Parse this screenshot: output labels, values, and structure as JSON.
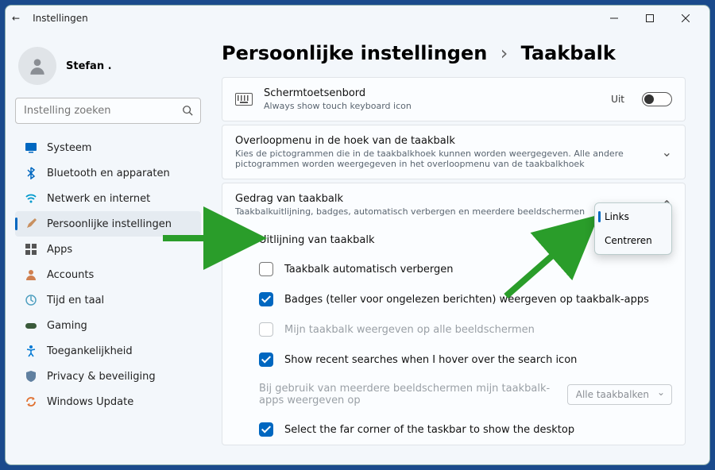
{
  "window": {
    "title": "Instellingen",
    "user": "Stefan .",
    "search_placeholder": "Instelling zoeken"
  },
  "nav": [
    {
      "label": "Systeem",
      "icon": "system"
    },
    {
      "label": "Bluetooth en apparaten",
      "icon": "bluetooth"
    },
    {
      "label": "Netwerk en internet",
      "icon": "network"
    },
    {
      "label": "Persoonlijke instellingen",
      "icon": "personalize",
      "active": true
    },
    {
      "label": "Apps",
      "icon": "apps"
    },
    {
      "label": "Accounts",
      "icon": "accounts"
    },
    {
      "label": "Tijd en taal",
      "icon": "time"
    },
    {
      "label": "Gaming",
      "icon": "gaming"
    },
    {
      "label": "Toegankelijkheid",
      "icon": "accessibility"
    },
    {
      "label": "Privacy & beveiliging",
      "icon": "privacy"
    },
    {
      "label": "Windows Update",
      "icon": "update"
    }
  ],
  "breadcrumb": {
    "parent": "Persoonlijke instellingen",
    "current": "Taakbalk"
  },
  "cards": {
    "touch_keyboard": {
      "title": "Schermtoetsenbord",
      "sub": "Always show touch keyboard icon",
      "state": "Uit"
    },
    "overflow": {
      "title": "Overloopmenu in de hoek van de taakbalk",
      "sub": "Kies de pictogrammen die in de taakbalkhoek kunnen worden weergegeven. Alle andere pictogrammen worden weergegeven in het overloopmenu van de taakbalkhoek"
    },
    "behavior": {
      "title": "Gedrag van taakbalk",
      "sub": "Taakbalkuitlijning, badges, automatisch verbergen en meerdere beeldschermen",
      "rows": {
        "alignment": "Uitlijning van taakbalk",
        "autohide": "Taakbalk automatisch verbergen",
        "badges": "Badges (teller voor ongelezen berichten) weergeven op taakbalk-apps",
        "multidisplay": "Mijn taakbalk weergeven op alle beeldschermen",
        "recent": "Show recent searches when I hover over the search icon",
        "multi_apps": "Bij gebruik van meerdere beeldschermen mijn taakbalk-apps weergeven op",
        "multi_dropdown": "Alle taakbalken",
        "corner": "Select the far corner of the taskbar to show the desktop"
      }
    }
  },
  "popup": {
    "option1": "Links",
    "option2": "Centreren"
  }
}
